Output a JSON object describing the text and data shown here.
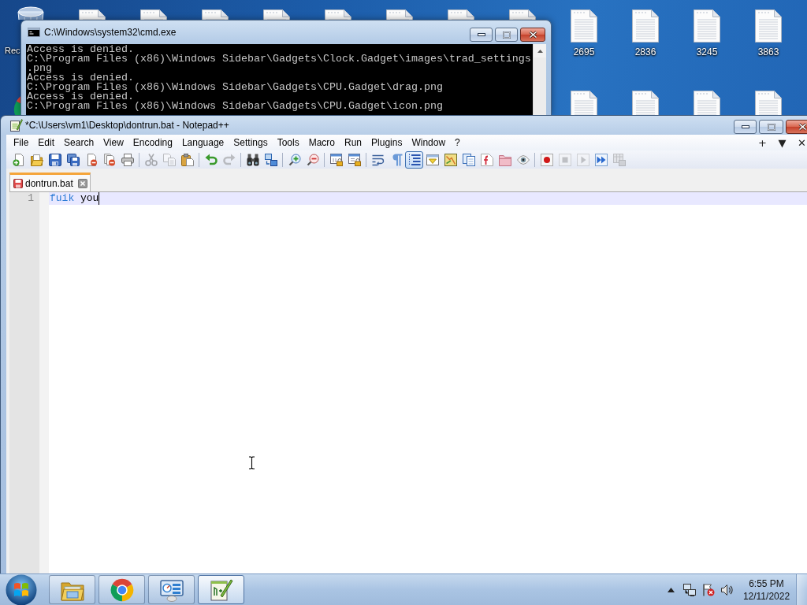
{
  "desktop": {
    "icons": [
      {
        "kind": "bin",
        "label": "Rec"
      },
      {
        "kind": "file"
      },
      {
        "kind": "file"
      },
      {
        "kind": "file"
      },
      {
        "kind": "file"
      },
      {
        "kind": "file"
      },
      {
        "kind": "file"
      },
      {
        "kind": "file"
      },
      {
        "kind": "file"
      },
      {
        "kind": "file",
        "label": "2695"
      },
      {
        "kind": "file",
        "label": "2836"
      },
      {
        "kind": "file",
        "label": "3245"
      },
      {
        "kind": "file",
        "label": "3863"
      }
    ],
    "second_row": [
      {
        "kind": "browser"
      },
      {
        "kind": "file"
      },
      {
        "kind": "file"
      },
      {
        "kind": "file"
      },
      {
        "kind": "file"
      }
    ]
  },
  "console_window": {
    "title": "C:\\Windows\\system32\\cmd.exe",
    "lines": [
      "Access is denied.",
      "C:\\Program Files (x86)\\Windows Sidebar\\Gadgets\\Clock.Gadget\\images\\trad_settings",
      ".png",
      "Access is denied.",
      "C:\\Program Files (x86)\\Windows Sidebar\\Gadgets\\CPU.Gadget\\drag.png",
      "Access is denied.",
      "C:\\Program Files (x86)\\Windows Sidebar\\Gadgets\\CPU.Gadget\\icon.png"
    ]
  },
  "editor_window": {
    "title": "*C:\\Users\\vm1\\Desktop\\dontrun.bat - Notepad++",
    "menu": [
      "File",
      "Edit",
      "Search",
      "View",
      "Encoding",
      "Language",
      "Settings",
      "Tools",
      "Macro",
      "Run",
      "Plugins",
      "Window",
      "?"
    ],
    "menu_right": [
      "+",
      "▼",
      "✕"
    ],
    "toolbar": [
      [
        {
          "kind": "new",
          "disabled": false,
          "pressed": false
        },
        {
          "kind": "open",
          "disabled": false,
          "pressed": false
        },
        {
          "kind": "save",
          "disabled": false,
          "pressed": false
        },
        {
          "kind": "saveall",
          "disabled": false,
          "pressed": false
        },
        {
          "kind": "close",
          "disabled": false,
          "pressed": false
        },
        {
          "kind": "closeall",
          "disabled": false,
          "pressed": false
        },
        {
          "kind": "print",
          "disabled": false,
          "pressed": false
        }
      ],
      [
        {
          "kind": "cut",
          "disabled": true,
          "pressed": false
        },
        {
          "kind": "copy",
          "disabled": true,
          "pressed": false
        },
        {
          "kind": "paste",
          "disabled": false,
          "pressed": false
        }
      ],
      [
        {
          "kind": "undo",
          "disabled": false,
          "pressed": false
        },
        {
          "kind": "redo",
          "disabled": true,
          "pressed": false
        }
      ],
      [
        {
          "kind": "find",
          "disabled": false,
          "pressed": false
        },
        {
          "kind": "replace",
          "disabled": false,
          "pressed": false
        }
      ],
      [
        {
          "kind": "zoomin",
          "disabled": false,
          "pressed": false
        },
        {
          "kind": "zoomout",
          "disabled": false,
          "pressed": false
        }
      ],
      [
        {
          "kind": "syncv",
          "disabled": false,
          "pressed": false
        },
        {
          "kind": "synch",
          "disabled": false,
          "pressed": false
        }
      ],
      [
        {
          "kind": "wrap",
          "disabled": false,
          "pressed": false
        },
        {
          "kind": "allchars",
          "disabled": false,
          "pressed": false
        },
        {
          "kind": "indent",
          "disabled": false,
          "pressed": true
        },
        {
          "kind": "udl",
          "disabled": false,
          "pressed": false
        },
        {
          "kind": "docmap",
          "disabled": false,
          "pressed": false
        },
        {
          "kind": "doclist",
          "disabled": false,
          "pressed": false
        },
        {
          "kind": "funclist",
          "disabled": false,
          "pressed": false
        },
        {
          "kind": "workspace",
          "disabled": false,
          "pressed": false
        },
        {
          "kind": "monitor",
          "disabled": false,
          "pressed": false
        }
      ],
      [
        {
          "kind": "record",
          "disabled": false,
          "pressed": false
        },
        {
          "kind": "stop",
          "disabled": true,
          "pressed": false
        },
        {
          "kind": "play",
          "disabled": true,
          "pressed": false
        },
        {
          "kind": "playmulti",
          "disabled": false,
          "pressed": false
        },
        {
          "kind": "savemacro",
          "disabled": true,
          "pressed": false
        }
      ]
    ],
    "tabs": [
      {
        "label": "dontrun.bat",
        "modified": true,
        "selected": true
      }
    ],
    "lines": [
      {
        "number": "1",
        "current": true,
        "tokens": [
          {
            "kind": "keyword",
            "text": "fuik"
          },
          {
            "kind": "plain",
            "text": " you"
          }
        ]
      }
    ]
  },
  "taskbar": {
    "apps": [
      {
        "kind": "folder",
        "selected": false
      },
      {
        "kind": "browser",
        "selected": false
      },
      {
        "kind": "panel",
        "selected": false
      },
      {
        "kind": "notepad",
        "selected": true
      }
    ],
    "time": "6:55 PM",
    "date": "12/11/2022"
  }
}
